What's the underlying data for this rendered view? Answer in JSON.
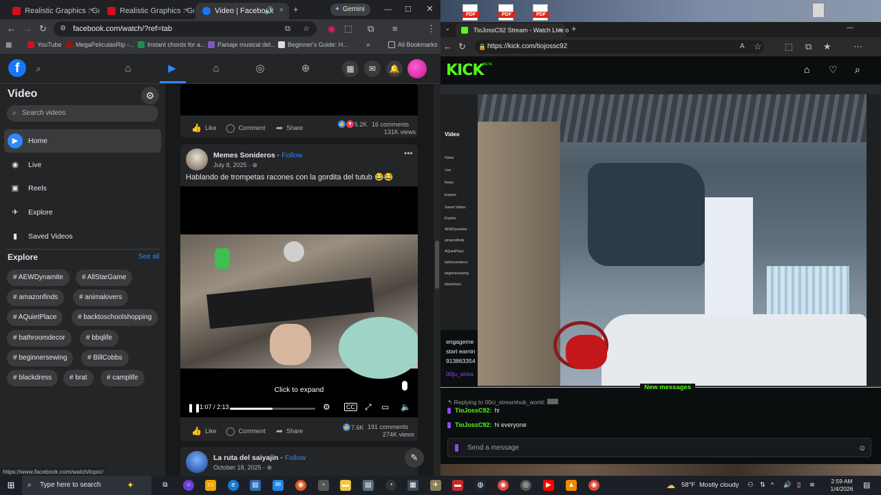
{
  "left_browser": {
    "tabs": [
      {
        "title": "Realistic Graphics : Grand",
        "close": "×"
      },
      {
        "title": "Realistic Graphics : Grand",
        "close": "×"
      },
      {
        "title": "Video | Facebook",
        "close": "×"
      }
    ],
    "gemini_label": "Gemini",
    "url": "facebook.com/watch/?ref=tab",
    "bookmarks": [
      "YouTube",
      "MegaPeliculasRip -...",
      "Instant chords for a...",
      "Paisaje musical del...",
      "Beginner's Guide: H..."
    ],
    "all_bookmarks": "All Bookmarks",
    "status_url": "https://www.facebook.com/watch/topic/"
  },
  "facebook": {
    "logo": "f",
    "sidebar": {
      "title": "Video",
      "search_placeholder": "Search videos",
      "items": [
        {
          "label": "Home",
          "icon": "play-icon"
        },
        {
          "label": "Live",
          "icon": "live-icon"
        },
        {
          "label": "Reels",
          "icon": "reels-icon"
        },
        {
          "label": "Explore",
          "icon": "explore-icon"
        },
        {
          "label": "Saved Videos",
          "icon": "bookmark-icon"
        }
      ],
      "explore_title": "Explore",
      "see_all": "See all",
      "topics": [
        "AEWDynamite",
        "AllStarGame",
        "amazonfinds",
        "animalovers",
        "AQuietPlace",
        "backtoschoolshopping",
        "bathroomdecor",
        "bbqlife",
        "beginnersewing",
        "BillCobbs",
        "blackdress",
        "brat",
        "camplife"
      ]
    },
    "post_top": {
      "like": "Like",
      "comment": "Comment",
      "share": "Share",
      "reactions": "5.2K",
      "comments": "16 comments",
      "views": "131K views"
    },
    "post_main": {
      "author": "Memes Sonideros",
      "follow": "Follow",
      "date": "July 8, 2025 ·",
      "caption": "Hablando de trompetas racones con la gordita del tutub 😂😂",
      "click_to_expand": "Click to expand",
      "time": "1:07 / 2:13",
      "progress": 0.5,
      "like": "Like",
      "comment": "Comment",
      "share": "Share",
      "reactions": "7.6K",
      "comments": "191 comments",
      "views": "274K views"
    },
    "post_next": {
      "author": "La ruta del saiyajin",
      "follow": "Follow",
      "date": "October 18, 2025 ·"
    }
  },
  "right_browser": {
    "pdf_label": "PDF",
    "tab_title": "TioJossC92 Stream - Watch Live o",
    "url": "https://kick.com/tiojossc92",
    "kick_logo": "KICK",
    "kick_beta": "BETA",
    "mini_sidebar": [
      "Video",
      "Home",
      "Live",
      "Reels",
      "Explore",
      "Saved Videos",
      "Explore",
      "AEWDynamite",
      "amazonfinds",
      "AQuietPlace",
      "bathroomdecor",
      "beginnersewing",
      "blackdress"
    ],
    "partial_chat": [
      "engageme",
      "start earnin",
      "913863354",
      "00ju_strea"
    ],
    "chat": {
      "new_messages": "New messages",
      "replying_to": "Replying to 00ci_streamhub_world:",
      "messages": [
        {
          "user": "TioJossC92:",
          "text": "hi"
        },
        {
          "user": "TioJossC92:",
          "text": "hi everyone"
        }
      ],
      "input_placeholder": "Send a message"
    }
  },
  "taskbar": {
    "search_placeholder": "Type here to search",
    "weather_temp": "58°F",
    "weather_text": "Mostly cloudy",
    "time": "2:59 AM",
    "date": "1/4/2026"
  },
  "colors": {
    "facebook_blue": "#2d88ff",
    "kick_green": "#53fc18",
    "fb_bg": "#18191a",
    "fb_surface": "#242526"
  }
}
